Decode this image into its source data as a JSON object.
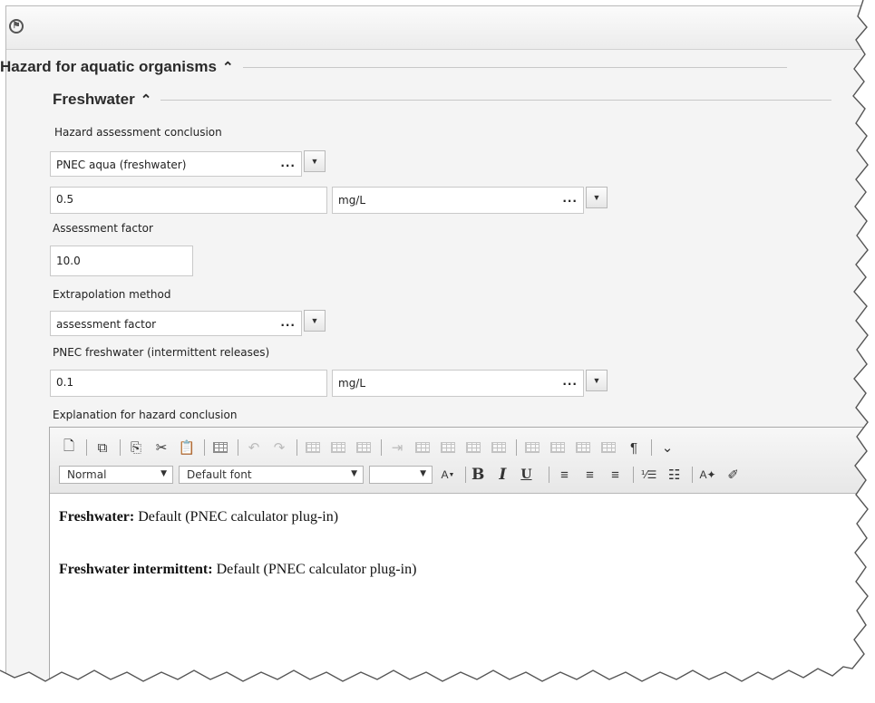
{
  "section": {
    "title": "Hazard for aquatic organisms"
  },
  "subsection": {
    "title": "Freshwater"
  },
  "fields": {
    "hazard_conclusion_label": "Hazard assessment conclusion",
    "hazard_conclusion_value": "PNEC aqua (freshwater)",
    "pnec_value": "0.5",
    "pnec_unit": "mg/L",
    "assessment_factor_label": "Assessment factor",
    "assessment_factor_value": "10.0",
    "extrapolation_label": "Extrapolation method",
    "extrapolation_value": "assessment factor",
    "pnec_intermittent_label": "PNEC freshwater (intermittent releases)",
    "pnec_intermittent_value": "0.1",
    "pnec_intermittent_unit": "mg/L",
    "explanation_label": "Explanation for hazard conclusion",
    "dots": "..."
  },
  "editor": {
    "style_select": "Normal",
    "font_select": "Default font",
    "size_select": "",
    "bold": "B",
    "italic": "I",
    "underline": "U",
    "pilcrow": "¶",
    "lines": [
      {
        "bold": "Freshwater:",
        "text": " Default (PNEC calculator plug-in)"
      },
      {
        "bold": "Freshwater intermittent:",
        "text": " Default (PNEC calculator plug-in)"
      }
    ]
  }
}
